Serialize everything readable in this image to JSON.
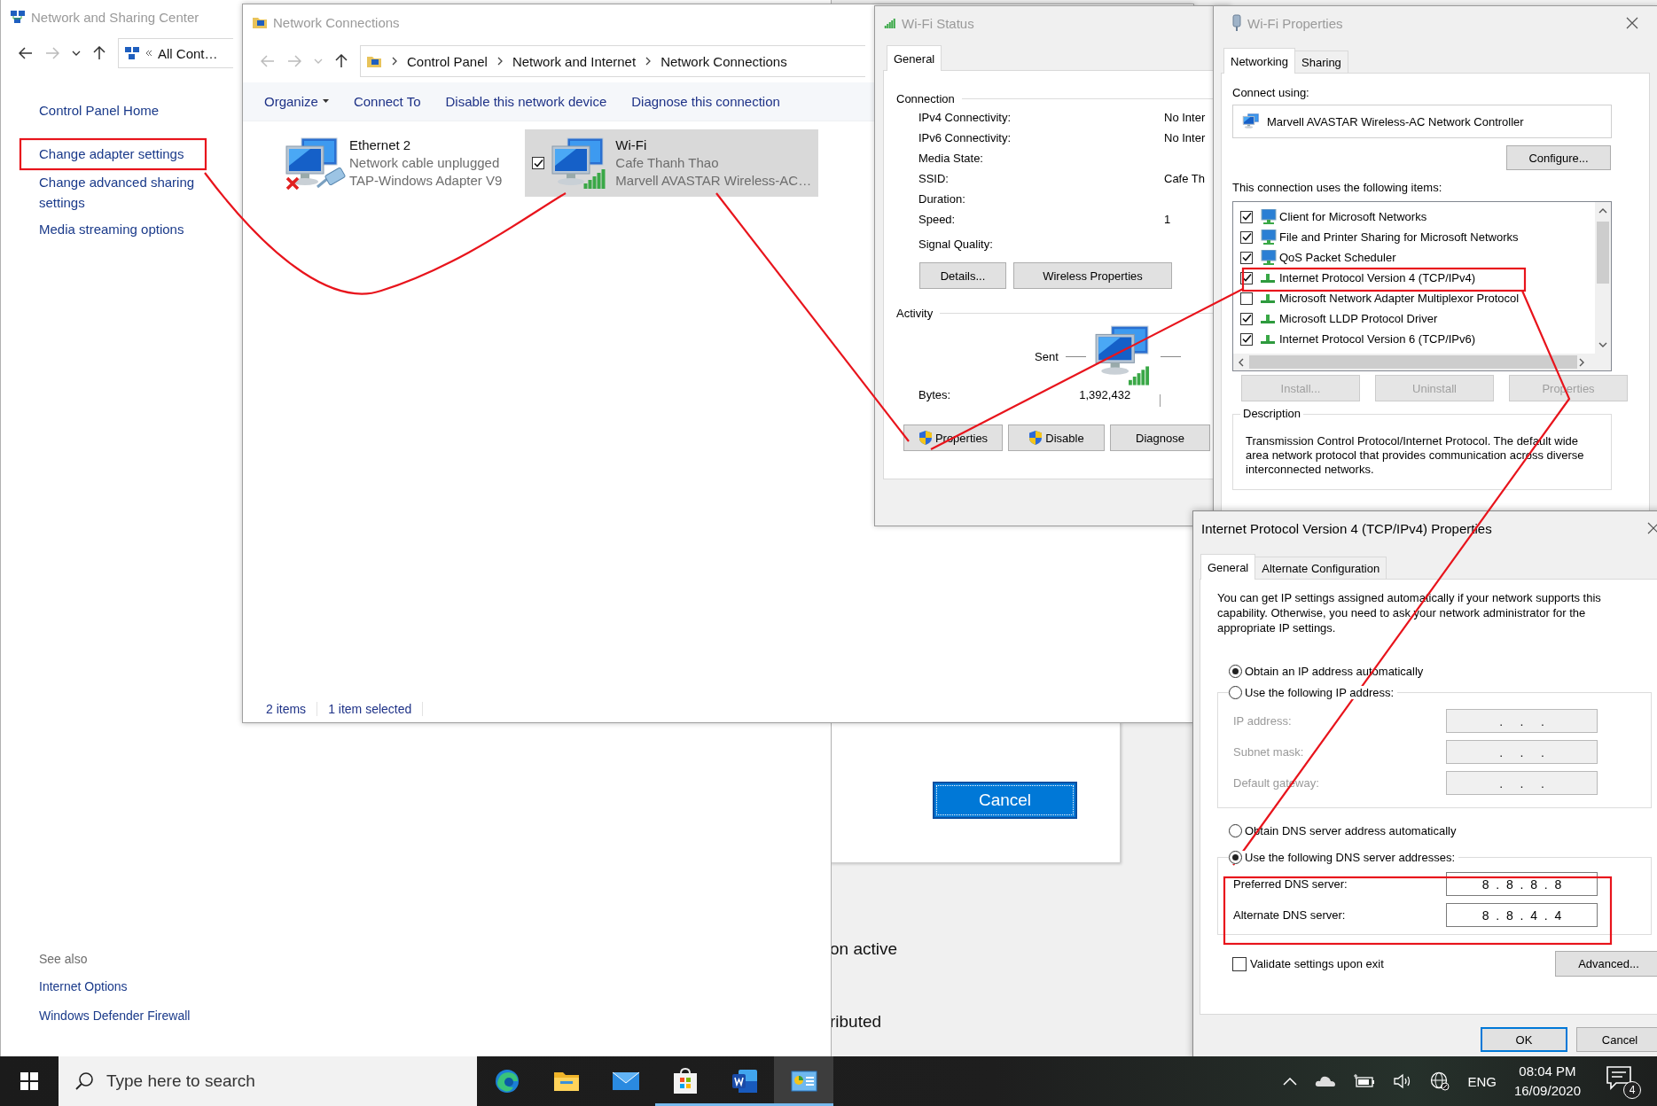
{
  "desktop": {
    "texts": [
      "on active",
      "ributed"
    ]
  },
  "background_dialog": {
    "button": {
      "label": "Cancel",
      "focused": true
    }
  },
  "sharing_center": {
    "title": "Network and Sharing Center",
    "address": "All Cont…",
    "links": [
      "Control Panel Home",
      "Change adapter settings",
      "Change advanced sharing settings",
      "Media streaming options"
    ],
    "see_also": {
      "heading": "See also",
      "links": [
        "Internet Options",
        "Windows Defender Firewall"
      ]
    }
  },
  "connections": {
    "title": "Network Connections",
    "breadcrumb": [
      "Control Panel",
      "Network and Internet",
      "Network Connections"
    ],
    "toolbar": [
      {
        "label": "Organize",
        "dropdown": true
      },
      {
        "label": "Connect To",
        "dropdown": false
      },
      {
        "label": "Disable this network device",
        "dropdown": false
      },
      {
        "label": "Diagnose this connection",
        "dropdown": false
      }
    ],
    "adapters": [
      {
        "kind": "ethernet",
        "name": "Ethernet 2",
        "status": "Network cable unplugged",
        "device": "TAP-Windows Adapter V9",
        "disconnected": true,
        "selected": false
      },
      {
        "kind": "wifi",
        "name": "Wi-Fi",
        "status": "Cafe Thanh Thao",
        "device": "Marvell AVASTAR Wireless-AC…",
        "disconnected": false,
        "selected": true
      }
    ],
    "status_bar": [
      "2 items",
      "1 item selected"
    ]
  },
  "wifi_status": {
    "title": "Wi-Fi Status",
    "tabs": [
      {
        "label": "General",
        "selected": true
      }
    ],
    "connection_heading": "Connection",
    "fields": [
      {
        "label": "IPv4 Connectivity:",
        "value": "No Inter"
      },
      {
        "label": "IPv6 Connectivity:",
        "value": "No Inter"
      },
      {
        "label": "Media State:"
      },
      {
        "label": "SSID:",
        "value": "Cafe Th"
      },
      {
        "label": "Duration:"
      },
      {
        "label": "Speed:",
        "value": "1"
      }
    ],
    "signal_label": "Signal Quality:",
    "buttons": [
      "Details...",
      "Wireless Properties"
    ],
    "activity_heading": "Activity",
    "sent_label": "Sent",
    "bytes_label": "Bytes:",
    "bytes_sent": "1,392,432",
    "actions": [
      {
        "label": "Properties",
        "shield": true
      },
      {
        "label": "Disable",
        "shield": true
      },
      {
        "label": "Diagnose",
        "shield": false
      }
    ]
  },
  "wifi_properties": {
    "title": "Wi-Fi Properties",
    "tabs": [
      {
        "label": "Networking",
        "selected": true
      },
      {
        "label": "Sharing",
        "selected": false
      }
    ],
    "connect_using": "Connect using:",
    "adapter": "Marvell AVASTAR Wireless-AC Network Controller",
    "configure": "Configure...",
    "items_label": "This connection uses the following items:",
    "items": [
      {
        "kind": "client",
        "label": "Client for Microsoft Networks",
        "checked": true
      },
      {
        "kind": "client",
        "label": "File and Printer Sharing for Microsoft Networks",
        "checked": true
      },
      {
        "kind": "client",
        "label": "QoS Packet Scheduler",
        "checked": true
      },
      {
        "kind": "protocol",
        "label": "Internet Protocol Version 4 (TCP/IPv4)",
        "checked": true
      },
      {
        "kind": "protocol",
        "label": "Microsoft Network Adapter Multiplexor Protocol",
        "checked": false
      },
      {
        "kind": "protocol",
        "label": "Microsoft LLDP Protocol Driver",
        "checked": true
      },
      {
        "kind": "protocol",
        "label": "Internet Protocol Version 6 (TCP/IPv6)",
        "checked": true
      }
    ],
    "buttons": [
      {
        "label": "Install...",
        "disabled": true
      },
      {
        "label": "Uninstall",
        "disabled": true
      },
      {
        "label": "Properties",
        "disabled": true
      }
    ],
    "description_heading": "Description",
    "description": "Transmission Control Protocol/Internet Protocol. The default wide area network protocol that provides communication across diverse interconnected networks."
  },
  "ipv4_properties": {
    "title": "Internet Protocol Version 4 (TCP/IPv4) Properties",
    "tabs": [
      {
        "label": "General",
        "selected": true
      },
      {
        "label": "Alternate Configuration",
        "selected": false
      }
    ],
    "intro": "You can get IP settings assigned automatically if your network supports this capability. Otherwise, you need to ask your network administrator for the appropriate IP settings.",
    "ip_options": [
      {
        "label": "Obtain an IP address automatically",
        "selected": true
      },
      {
        "label": "Use the following IP address:",
        "selected": false
      }
    ],
    "ip_fields": [
      {
        "label": "IP address:",
        "value": ".     .     .",
        "disabled": true
      },
      {
        "label": "Subnet mask:",
        "value": ".     .     .",
        "disabled": true
      },
      {
        "label": "Default gateway:",
        "value": ".     .     .",
        "disabled": true
      }
    ],
    "dns_options": [
      {
        "label": "Obtain DNS server address automatically",
        "selected": false
      },
      {
        "label": "Use the following DNS server addresses:",
        "selected": true
      }
    ],
    "dns_fields": [
      {
        "label": "Preferred DNS server:",
        "value": "8  .  8  .  8  .  8",
        "disabled": false
      },
      {
        "label": "Alternate DNS server:",
        "value": "8  .  8  .  4  .  4",
        "disabled": false
      }
    ],
    "validate": {
      "label": "Validate settings upon exit",
      "checked": false
    },
    "advanced": "Advanced...",
    "ok": "OK",
    "cancel": "Cancel"
  },
  "taskbar": {
    "search_placeholder": "Type here to search",
    "apps": [
      {
        "kind": "edge",
        "running": false,
        "active": false
      },
      {
        "kind": "explorer",
        "running": false,
        "active": false
      },
      {
        "kind": "mail",
        "running": false,
        "active": false
      },
      {
        "kind": "store",
        "running": true,
        "active": false
      },
      {
        "kind": "word",
        "running": true,
        "active": false
      },
      {
        "kind": "control_panel",
        "running": true,
        "active": true
      }
    ],
    "language": "ENG",
    "time": "08:04 PM",
    "date": "16/09/2020",
    "notifications": "4"
  }
}
